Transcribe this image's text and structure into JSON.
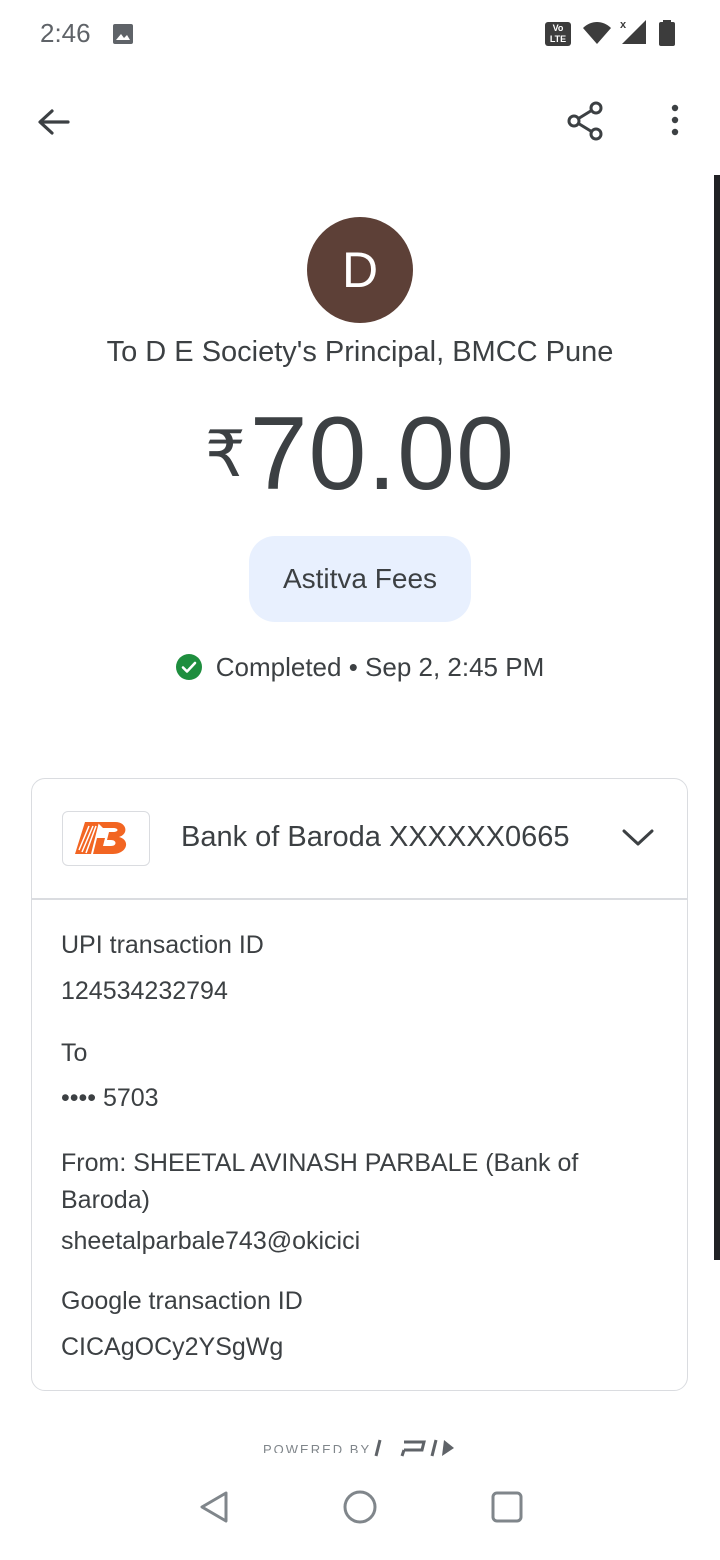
{
  "status_bar": {
    "time": "2:46",
    "volte_label": "Vo\nLTE"
  },
  "payee": {
    "avatar_letter": "D",
    "name": "To D E Society's Principal, BMCC Pune"
  },
  "payment": {
    "currency": "₹",
    "amount": "70.00",
    "note": "Astitva Fees",
    "status": "Completed • Sep 2, 2:45 PM"
  },
  "bank": {
    "account": "Bank of Baroda XXXXXX0665"
  },
  "details": {
    "upi_txn_label": "UPI transaction ID",
    "upi_txn_value": "124534232794",
    "to_label": "To",
    "to_value": "•••• 5703",
    "from_label": "From: SHEETAL AVINASH PARBALE (Bank of Baroda)",
    "from_value": "sheetalparbale743@okicici",
    "google_txn_label": "Google transaction ID",
    "google_txn_value": "CICAgOCy2YSgWg"
  },
  "footer": {
    "powered_by": "POWERED BY"
  },
  "colors": {
    "avatar": "#5d4037",
    "chip": "#e8f0fe",
    "success": "#1e8e3e",
    "bank_brand": "#f26522"
  },
  "icons": [
    "gallery-icon",
    "volte-icon",
    "wifi-icon",
    "signal-icon",
    "battery-icon",
    "back-arrow-icon",
    "share-icon",
    "more-vert-icon",
    "check-circle-icon",
    "bank-of-baroda-logo",
    "chevron-down-icon",
    "upi-logo",
    "nav-back-icon",
    "nav-home-icon",
    "nav-recents-icon"
  ]
}
